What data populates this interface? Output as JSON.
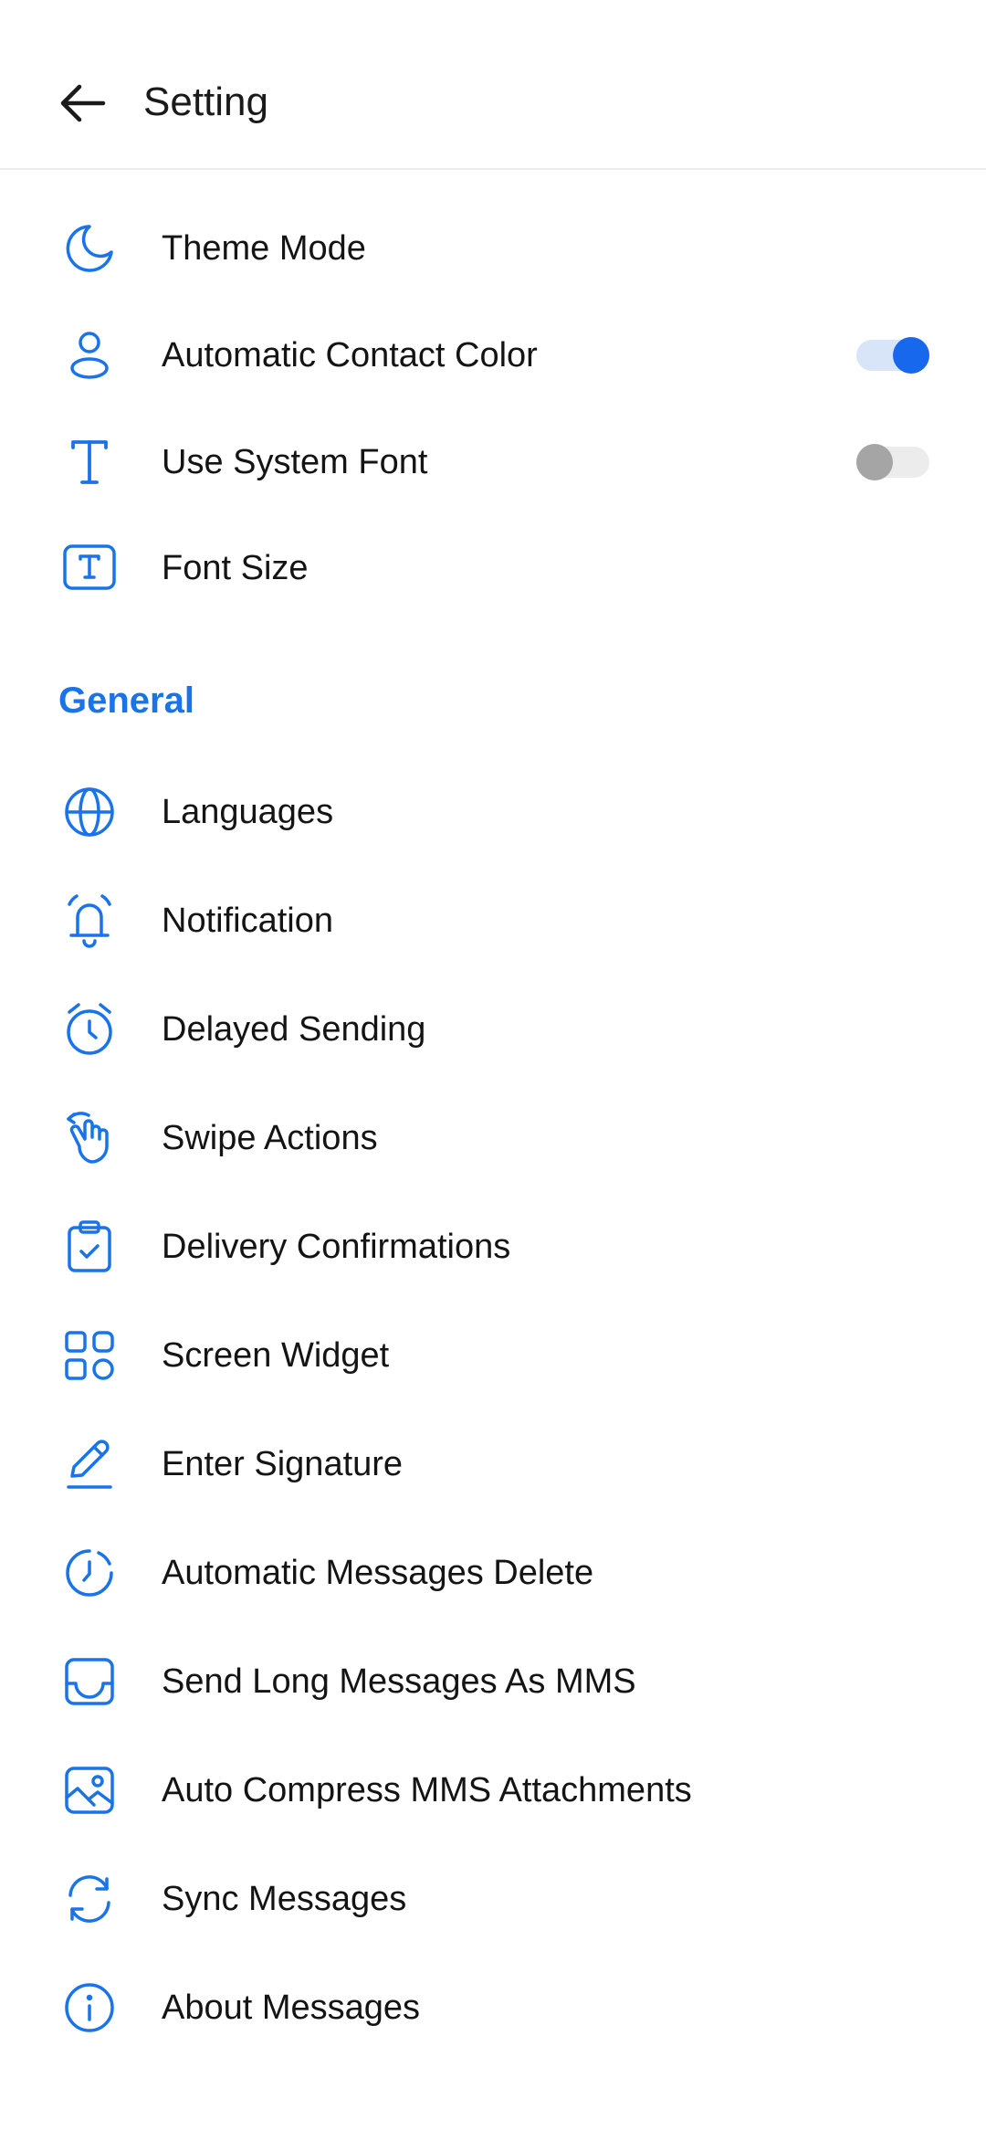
{
  "header": {
    "title": "Setting"
  },
  "theme": {
    "accent_color": "#1a73e8",
    "toggle_on_color": "#1768ec",
    "toggle_off_color": "#a5a5a5"
  },
  "display_items": [
    {
      "label": "Theme Mode",
      "icon": "moon-icon"
    },
    {
      "label": "Automatic Contact Color",
      "icon": "user-icon",
      "toggle": true
    },
    {
      "label": "Use System Font",
      "icon": "text-icon",
      "toggle": false
    },
    {
      "label": "Font Size",
      "icon": "font-size-icon"
    }
  ],
  "general": {
    "title": "General",
    "items": [
      {
        "label": "Languages",
        "icon": "globe-icon"
      },
      {
        "label": "Notification",
        "icon": "bell-icon"
      },
      {
        "label": "Delayed Sending",
        "icon": "alarm-clock-icon"
      },
      {
        "label": "Swipe Actions",
        "icon": "swipe-hand-icon"
      },
      {
        "label": "Delivery Confirmations",
        "icon": "clipboard-check-icon"
      },
      {
        "label": "Screen Widget",
        "icon": "widget-grid-icon"
      },
      {
        "label": "Enter Signature",
        "icon": "pencil-icon"
      },
      {
        "label": "Automatic Messages Delete",
        "icon": "history-icon"
      },
      {
        "label": "Send Long Messages As MMS",
        "icon": "inbox-icon"
      },
      {
        "label": "Auto Compress MMS Attachments",
        "icon": "image-icon"
      },
      {
        "label": "Sync Messages",
        "icon": "sync-icon"
      },
      {
        "label": "About Messages",
        "icon": "info-icon"
      }
    ]
  }
}
